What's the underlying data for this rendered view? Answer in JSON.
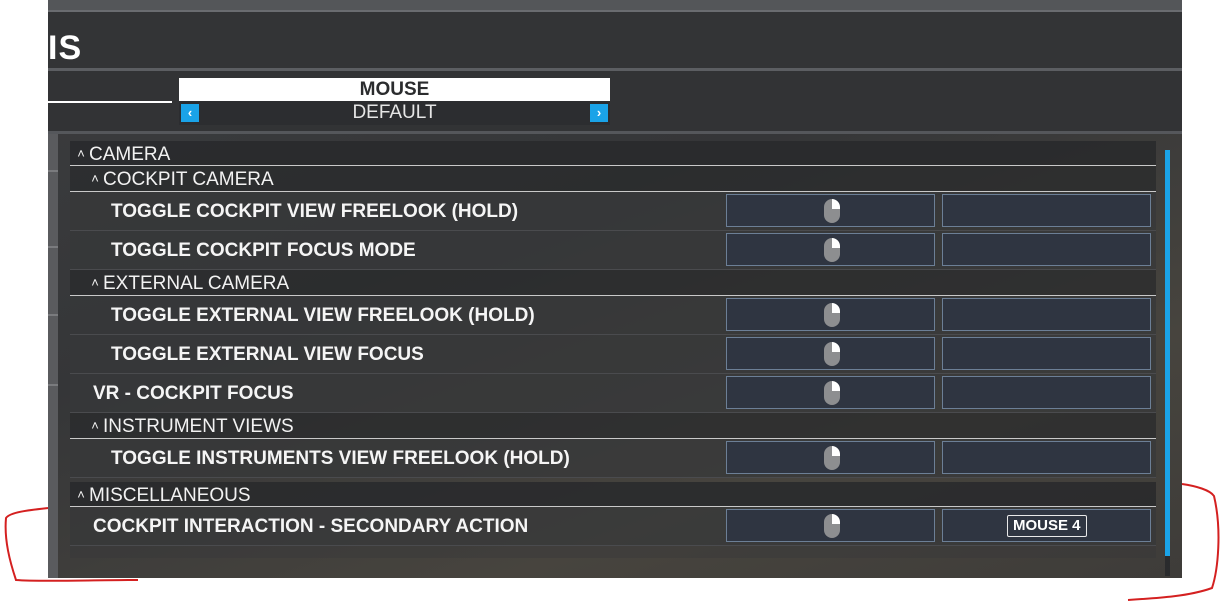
{
  "header": {
    "title_fragment": "IS"
  },
  "preset": {
    "name": "MOUSE",
    "selected": "DEFAULT",
    "prev_glyph": "‹",
    "next_glyph": "›"
  },
  "sections": {
    "camera": {
      "caret": "˄",
      "label": "CAMERA"
    },
    "cockpit_camera": {
      "caret": "˄",
      "label": "COCKPIT CAMERA"
    },
    "external_camera": {
      "caret": "˄",
      "label": "EXTERNAL CAMERA"
    },
    "instrument_views": {
      "caret": "˄",
      "label": "INSTRUMENT VIEWS"
    },
    "misc": {
      "caret": "˄",
      "label": "MISCELLANEOUS"
    }
  },
  "bindings": {
    "b1": {
      "label": "TOGGLE COCKPIT VIEW FREELOOK (HOLD)",
      "slot_a_icon": "mouse-icon",
      "slot_b": ""
    },
    "b2": {
      "label": "TOGGLE COCKPIT FOCUS MODE",
      "slot_a_icon": "mouse-icon",
      "slot_b": ""
    },
    "b3": {
      "label": "TOGGLE EXTERNAL VIEW FREELOOK (HOLD)",
      "slot_a_icon": "mouse-icon",
      "slot_b": ""
    },
    "b4": {
      "label": "TOGGLE EXTERNAL VIEW FOCUS",
      "slot_a_icon": "mouse-icon",
      "slot_b": ""
    },
    "b5": {
      "label": "VR - COCKPIT FOCUS",
      "slot_a_icon": "mouse-icon",
      "slot_b": ""
    },
    "b6": {
      "label": "TOGGLE INSTRUMENTS VIEW FREELOOK (HOLD)",
      "slot_a_icon": "mouse-icon",
      "slot_b": ""
    },
    "b7": {
      "label": "COCKPIT INTERACTION - SECONDARY ACTION",
      "slot_a_icon": "mouse-icon",
      "slot_b": "MOUSE 4"
    }
  },
  "colors": {
    "accent": "#1aa3e8",
    "annotation": "#d42020",
    "slot_border": "#6c7f96"
  }
}
